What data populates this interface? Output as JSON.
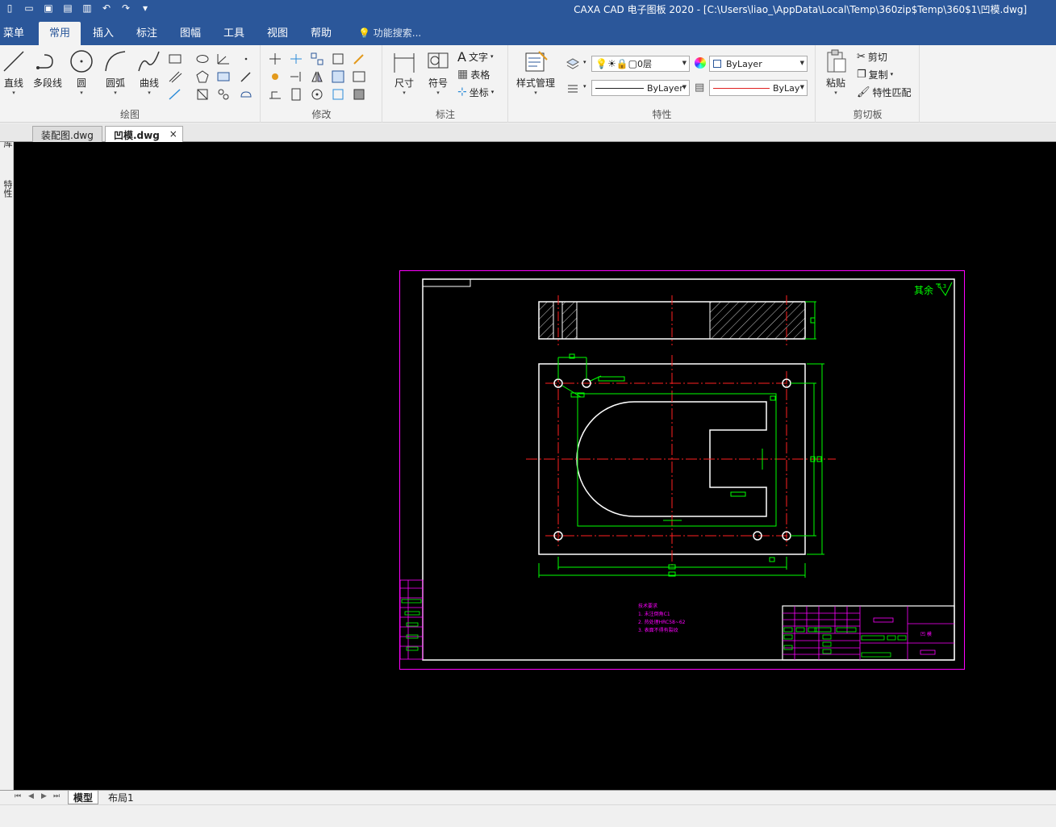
{
  "window": {
    "title": "CAXA CAD 电子图板 2020 - [C:\\Users\\liao_\\AppData\\Local\\Temp\\360zip$Temp\\360$1\\凹模.dwg]"
  },
  "quick_access": {
    "icons": [
      "new-file-icon",
      "open-folder-icon",
      "save-icon",
      "save-as-icon",
      "print-icon",
      "undo-icon",
      "redo-icon",
      "customize-icon"
    ]
  },
  "ribbon_tabs": [
    "菜单",
    "常用",
    "插入",
    "标注",
    "图幅",
    "工具",
    "视图",
    "帮助"
  ],
  "active_tab": "常用",
  "search_placeholder": "功能搜索...",
  "ribbon": {
    "draw": {
      "label": "绘图",
      "buttons": [
        "直线",
        "多段线",
        "圆",
        "圆弧",
        "曲线"
      ]
    },
    "modify": {
      "label": "修改"
    },
    "annotate": {
      "label": "标注",
      "buttons": [
        "尺寸",
        "符号"
      ],
      "small": [
        "文字",
        "表格",
        "坐标"
      ]
    },
    "properties": {
      "label": "特性",
      "style_button": "样式管理",
      "layer_value": "0层",
      "color_value": "ByLayer",
      "linetype_value": "ByLayer",
      "lineweight_value": "ByLay"
    },
    "clipboard": {
      "label": "剪切板",
      "paste": "粘贴",
      "small": [
        "剪切",
        "复制",
        "特性匹配"
      ]
    }
  },
  "documents": [
    {
      "name": "装配图.dwg",
      "active": false
    },
    {
      "name": "凹模.dwg",
      "active": true
    }
  ],
  "doc_close": "×",
  "left_panel": [
    "图库",
    "特性"
  ],
  "layout_tabs": [
    "模型",
    "布局1"
  ],
  "active_layout": "模型",
  "drawing": {
    "roughness_note": "其余",
    "roughness_value": "6.3",
    "tech_requirements": [
      "技术要求",
      "1. 未注倒角C1",
      "2. 热处理HRC58~62",
      "3. 表面不得有裂纹"
    ],
    "title_block_name": "凹 模"
  },
  "colors": {
    "title_bar": "#2b579a",
    "canvas": "#000000",
    "white_line": "#ffffff",
    "dim_green": "#00ff00",
    "center_red": "#ff2020",
    "frame_magenta": "#ff00ff"
  }
}
